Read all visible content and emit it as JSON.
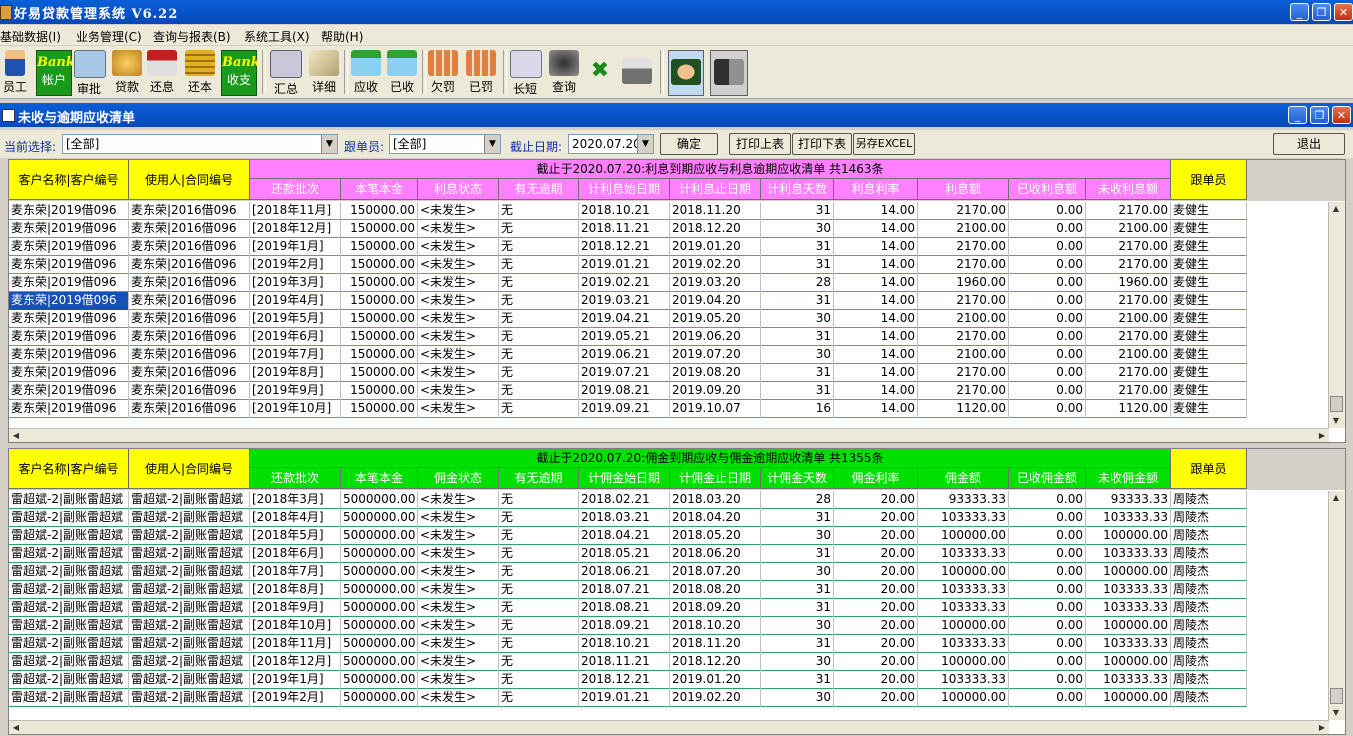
{
  "window": {
    "title": "好易贷款管理系统 V6.22"
  },
  "menu": [
    "基础数据(I)",
    "业务管理(C)",
    "查询与报表(B)",
    "系统工具(X)",
    "帮助(H)"
  ],
  "toolbar": {
    "emp": "员工",
    "bank_word": "Bank",
    "account": "帐户",
    "approve": "审批",
    "loan": "贷款",
    "repay_interest": "还息",
    "repay_principal": "还本",
    "cash": "收支",
    "summary": "汇总",
    "detail": "详细",
    "receivable": "应收",
    "received": "已收",
    "owed_fine": "欠罚",
    "paid_fine": "已罚",
    "long_short": "长短",
    "query": "查询"
  },
  "subwindow": {
    "title": "未收与逾期应收清单"
  },
  "filter": {
    "current_label": "当前选择:",
    "current_value": "[全部]",
    "follower_label": "跟单员:",
    "follower_value": "[全部]",
    "date_label": "截止日期:",
    "date_value": "2020.07.20",
    "ok": "确定",
    "print_top": "打印上表",
    "print_bottom": "打印下表",
    "save_excel": "另存EXCEL",
    "exit": "退出"
  },
  "colors": {
    "interest_header": "#ff80ff",
    "commission_header": "#00e000",
    "name_header": "#ffff00",
    "selected": "#1a4fb8"
  },
  "interest_table": {
    "banner": "截止于2020.07.20:利息到期应收与利息逾期应收清单 共1463条",
    "col_customer": "客户名称|客户编号",
    "col_user": "使用人|合同编号",
    "col_follower": "跟单员",
    "columns": [
      "还款批次",
      "本笔本金",
      "利息状态",
      "有无逾期",
      "计利息始日期",
      "计利息止日期",
      "计利息天数",
      "利息利率",
      "利息额",
      "已收利息额",
      "未收利息额"
    ],
    "selected_row": 5,
    "rows": [
      [
        "麦东荣|2019借096",
        "麦东荣|2016借096",
        "[2018年11月]",
        "150000.00",
        "<未发生>",
        "无",
        "2018.10.21",
        "2018.11.20",
        "31",
        "14.00",
        "2170.00",
        "0.00",
        "2170.00",
        "麦健生"
      ],
      [
        "麦东荣|2019借096",
        "麦东荣|2016借096",
        "[2018年12月]",
        "150000.00",
        "<未发生>",
        "无",
        "2018.11.21",
        "2018.12.20",
        "30",
        "14.00",
        "2100.00",
        "0.00",
        "2100.00",
        "麦健生"
      ],
      [
        "麦东荣|2019借096",
        "麦东荣|2016借096",
        "[2019年1月]",
        "150000.00",
        "<未发生>",
        "无",
        "2018.12.21",
        "2019.01.20",
        "31",
        "14.00",
        "2170.00",
        "0.00",
        "2170.00",
        "麦健生"
      ],
      [
        "麦东荣|2019借096",
        "麦东荣|2016借096",
        "[2019年2月]",
        "150000.00",
        "<未发生>",
        "无",
        "2019.01.21",
        "2019.02.20",
        "31",
        "14.00",
        "2170.00",
        "0.00",
        "2170.00",
        "麦健生"
      ],
      [
        "麦东荣|2019借096",
        "麦东荣|2016借096",
        "[2019年3月]",
        "150000.00",
        "<未发生>",
        "无",
        "2019.02.21",
        "2019.03.20",
        "28",
        "14.00",
        "1960.00",
        "0.00",
        "1960.00",
        "麦健生"
      ],
      [
        "麦东荣|2019借096",
        "麦东荣|2016借096",
        "[2019年4月]",
        "150000.00",
        "<未发生>",
        "无",
        "2019.03.21",
        "2019.04.20",
        "31",
        "14.00",
        "2170.00",
        "0.00",
        "2170.00",
        "麦健生"
      ],
      [
        "麦东荣|2019借096",
        "麦东荣|2016借096",
        "[2019年5月]",
        "150000.00",
        "<未发生>",
        "无",
        "2019.04.21",
        "2019.05.20",
        "30",
        "14.00",
        "2100.00",
        "0.00",
        "2100.00",
        "麦健生"
      ],
      [
        "麦东荣|2019借096",
        "麦东荣|2016借096",
        "[2019年6月]",
        "150000.00",
        "<未发生>",
        "无",
        "2019.05.21",
        "2019.06.20",
        "31",
        "14.00",
        "2170.00",
        "0.00",
        "2170.00",
        "麦健生"
      ],
      [
        "麦东荣|2019借096",
        "麦东荣|2016借096",
        "[2019年7月]",
        "150000.00",
        "<未发生>",
        "无",
        "2019.06.21",
        "2019.07.20",
        "30",
        "14.00",
        "2100.00",
        "0.00",
        "2100.00",
        "麦健生"
      ],
      [
        "麦东荣|2019借096",
        "麦东荣|2016借096",
        "[2019年8月]",
        "150000.00",
        "<未发生>",
        "无",
        "2019.07.21",
        "2019.08.20",
        "31",
        "14.00",
        "2170.00",
        "0.00",
        "2170.00",
        "麦健生"
      ],
      [
        "麦东荣|2019借096",
        "麦东荣|2016借096",
        "[2019年9月]",
        "150000.00",
        "<未发生>",
        "无",
        "2019.08.21",
        "2019.09.20",
        "31",
        "14.00",
        "2170.00",
        "0.00",
        "2170.00",
        "麦健生"
      ],
      [
        "麦东荣|2019借096",
        "麦东荣|2016借096",
        "[2019年10月]",
        "150000.00",
        "<未发生>",
        "无",
        "2019.09.21",
        "2019.10.07",
        "16",
        "14.00",
        "1120.00",
        "0.00",
        "1120.00",
        "麦健生"
      ]
    ]
  },
  "commission_table": {
    "banner": "截止于2020.07.20:佣金到期应收与佣金逾期应收清单 共1355条",
    "col_customer": "客户名称|客户编号",
    "col_user": "使用人|合同编号",
    "col_follower": "跟单员",
    "columns": [
      "还款批次",
      "本笔本金",
      "佣金状态",
      "有无逾期",
      "计佣金始日期",
      "计佣金止日期",
      "计佣金天数",
      "佣金利率",
      "佣金额",
      "已收佣金额",
      "未收佣金额"
    ],
    "rows": [
      [
        "雷超斌-2|副账雷超斌",
        "雷超斌-2|副账雷超斌",
        "[2018年3月]",
        "5000000.00",
        "<未发生>",
        "无",
        "2018.02.21",
        "2018.03.20",
        "28",
        "20.00",
        "93333.33",
        "0.00",
        "93333.33",
        "周陵杰"
      ],
      [
        "雷超斌-2|副账雷超斌",
        "雷超斌-2|副账雷超斌",
        "[2018年4月]",
        "5000000.00",
        "<未发生>",
        "无",
        "2018.03.21",
        "2018.04.20",
        "31",
        "20.00",
        "103333.33",
        "0.00",
        "103333.33",
        "周陵杰"
      ],
      [
        "雷超斌-2|副账雷超斌",
        "雷超斌-2|副账雷超斌",
        "[2018年5月]",
        "5000000.00",
        "<未发生>",
        "无",
        "2018.04.21",
        "2018.05.20",
        "30",
        "20.00",
        "100000.00",
        "0.00",
        "100000.00",
        "周陵杰"
      ],
      [
        "雷超斌-2|副账雷超斌",
        "雷超斌-2|副账雷超斌",
        "[2018年6月]",
        "5000000.00",
        "<未发生>",
        "无",
        "2018.05.21",
        "2018.06.20",
        "31",
        "20.00",
        "103333.33",
        "0.00",
        "103333.33",
        "周陵杰"
      ],
      [
        "雷超斌-2|副账雷超斌",
        "雷超斌-2|副账雷超斌",
        "[2018年7月]",
        "5000000.00",
        "<未发生>",
        "无",
        "2018.06.21",
        "2018.07.20",
        "30",
        "20.00",
        "100000.00",
        "0.00",
        "100000.00",
        "周陵杰"
      ],
      [
        "雷超斌-2|副账雷超斌",
        "雷超斌-2|副账雷超斌",
        "[2018年8月]",
        "5000000.00",
        "<未发生>",
        "无",
        "2018.07.21",
        "2018.08.20",
        "31",
        "20.00",
        "103333.33",
        "0.00",
        "103333.33",
        "周陵杰"
      ],
      [
        "雷超斌-2|副账雷超斌",
        "雷超斌-2|副账雷超斌",
        "[2018年9月]",
        "5000000.00",
        "<未发生>",
        "无",
        "2018.08.21",
        "2018.09.20",
        "31",
        "20.00",
        "103333.33",
        "0.00",
        "103333.33",
        "周陵杰"
      ],
      [
        "雷超斌-2|副账雷超斌",
        "雷超斌-2|副账雷超斌",
        "[2018年10月]",
        "5000000.00",
        "<未发生>",
        "无",
        "2018.09.21",
        "2018.10.20",
        "30",
        "20.00",
        "100000.00",
        "0.00",
        "100000.00",
        "周陵杰"
      ],
      [
        "雷超斌-2|副账雷超斌",
        "雷超斌-2|副账雷超斌",
        "[2018年11月]",
        "5000000.00",
        "<未发生>",
        "无",
        "2018.10.21",
        "2018.11.20",
        "31",
        "20.00",
        "103333.33",
        "0.00",
        "103333.33",
        "周陵杰"
      ],
      [
        "雷超斌-2|副账雷超斌",
        "雷超斌-2|副账雷超斌",
        "[2018年12月]",
        "5000000.00",
        "<未发生>",
        "无",
        "2018.11.21",
        "2018.12.20",
        "30",
        "20.00",
        "100000.00",
        "0.00",
        "100000.00",
        "周陵杰"
      ],
      [
        "雷超斌-2|副账雷超斌",
        "雷超斌-2|副账雷超斌",
        "[2019年1月]",
        "5000000.00",
        "<未发生>",
        "无",
        "2018.12.21",
        "2019.01.20",
        "31",
        "20.00",
        "103333.33",
        "0.00",
        "103333.33",
        "周陵杰"
      ],
      [
        "雷超斌-2|副账雷超斌",
        "雷超斌-2|副账雷超斌",
        "[2019年2月]",
        "5000000.00",
        "<未发生>",
        "无",
        "2019.01.21",
        "2019.02.20",
        "30",
        "20.00",
        "100000.00",
        "0.00",
        "100000.00",
        "周陵杰"
      ]
    ]
  }
}
